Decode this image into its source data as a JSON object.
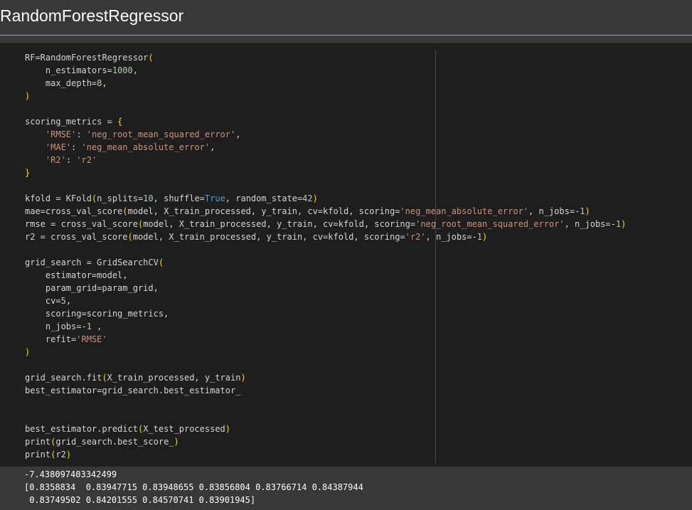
{
  "title": "RandomForestRegressor",
  "colors": {
    "string": "#ce9178",
    "number": "#b5cea8",
    "keyword": "#569cd6",
    "bracket": "#ffd700",
    "text": "#d4d4d4",
    "cell_background": "#1e1e1e",
    "page_background": "#383838"
  },
  "code_lines": [
    [
      {
        "t": "RF=RandomForestRegressor"
      },
      {
        "t": "(",
        "c": "br"
      }
    ],
    [
      {
        "t": "    n_estimators="
      },
      {
        "t": "1000",
        "c": "num"
      },
      {
        "t": ","
      }
    ],
    [
      {
        "t": "    max_depth="
      },
      {
        "t": "8",
        "c": "num"
      },
      {
        "t": ","
      }
    ],
    [
      {
        "t": ")",
        "c": "br"
      }
    ],
    [],
    [
      {
        "t": "scoring_metrics = "
      },
      {
        "t": "{",
        "c": "br"
      }
    ],
    [
      {
        "t": "    "
      },
      {
        "t": "'RMSE'",
        "c": "str"
      },
      {
        "t": ": "
      },
      {
        "t": "'neg_root_mean_squared_error'",
        "c": "str"
      },
      {
        "t": ","
      }
    ],
    [
      {
        "t": "    "
      },
      {
        "t": "'MAE'",
        "c": "str"
      },
      {
        "t": ": "
      },
      {
        "t": "'neg_mean_absolute_error'",
        "c": "str"
      },
      {
        "t": ","
      }
    ],
    [
      {
        "t": "    "
      },
      {
        "t": "'R2'",
        "c": "str"
      },
      {
        "t": ": "
      },
      {
        "t": "'r2'",
        "c": "str"
      }
    ],
    [
      {
        "t": "}",
        "c": "br"
      }
    ],
    [],
    [
      {
        "t": "kfold = KFold"
      },
      {
        "t": "(",
        "c": "br"
      },
      {
        "t": "n_splits="
      },
      {
        "t": "10",
        "c": "num"
      },
      {
        "t": ", shuffle="
      },
      {
        "t": "True",
        "c": "kw"
      },
      {
        "t": ", random_state="
      },
      {
        "t": "42",
        "c": "num"
      },
      {
        "t": ")",
        "c": "br"
      }
    ],
    [
      {
        "t": "mae=cross_val_score"
      },
      {
        "t": "(",
        "c": "br"
      },
      {
        "t": "model, X_train_processed, y_train, cv=kfold, scoring="
      },
      {
        "t": "'neg_mean_absolute_error'",
        "c": "str"
      },
      {
        "t": ", n_jobs=-"
      },
      {
        "t": "1",
        "c": "num"
      },
      {
        "t": ")",
        "c": "br"
      }
    ],
    [
      {
        "t": "rmse = cross_val_score"
      },
      {
        "t": "(",
        "c": "br"
      },
      {
        "t": "model, X_train_processed, y_train, cv=kfold, scoring="
      },
      {
        "t": "'neg_root_mean_squared_error'",
        "c": "str"
      },
      {
        "t": ", n_jobs=-"
      },
      {
        "t": "1",
        "c": "num"
      },
      {
        "t": ")",
        "c": "br"
      }
    ],
    [
      {
        "t": "r2 = cross_val_score"
      },
      {
        "t": "(",
        "c": "br"
      },
      {
        "t": "model, X_train_processed, y_train, cv=kfold, scoring="
      },
      {
        "t": "'r2'",
        "c": "str"
      },
      {
        "t": ", n_jobs=-"
      },
      {
        "t": "1",
        "c": "num"
      },
      {
        "t": ")",
        "c": "br"
      }
    ],
    [],
    [
      {
        "t": "grid_search = GridSearchCV"
      },
      {
        "t": "(",
        "c": "br"
      }
    ],
    [
      {
        "t": "    estimator=model,"
      }
    ],
    [
      {
        "t": "    param_grid=param_grid,"
      }
    ],
    [
      {
        "t": "    cv="
      },
      {
        "t": "5",
        "c": "num"
      },
      {
        "t": ","
      }
    ],
    [
      {
        "t": "    scoring=scoring_metrics,"
      }
    ],
    [
      {
        "t": "    n_jobs=-"
      },
      {
        "t": "1",
        "c": "num"
      },
      {
        "t": " ,"
      }
    ],
    [
      {
        "t": "    refit="
      },
      {
        "t": "'RMSE'",
        "c": "str"
      }
    ],
    [
      {
        "t": ")",
        "c": "br"
      }
    ],
    [],
    [
      {
        "t": "grid_search.fit"
      },
      {
        "t": "(",
        "c": "br"
      },
      {
        "t": "X_train_processed, y_train"
      },
      {
        "t": ")",
        "c": "br"
      }
    ],
    [
      {
        "t": "best_estimator=grid_search.best_estimator_"
      }
    ],
    [],
    [],
    [
      {
        "t": "best_estimator.predict"
      },
      {
        "t": "(",
        "c": "br"
      },
      {
        "t": "X_test_processed"
      },
      {
        "t": ")",
        "c": "br"
      }
    ],
    [
      {
        "t": "print"
      },
      {
        "t": "(",
        "c": "br"
      },
      {
        "t": "grid_search.best_score_"
      },
      {
        "t": ")",
        "c": "br"
      }
    ],
    [
      {
        "t": "print"
      },
      {
        "t": "(",
        "c": "br"
      },
      {
        "t": "r2"
      },
      {
        "t": ")",
        "c": "br"
      }
    ]
  ],
  "output_lines": [
    "-7.438097403342499",
    "[0.8358834  0.83947715 0.83948655 0.83856804 0.83766714 0.84387944",
    " 0.83749502 0.84201555 0.84570741 0.83901945]"
  ]
}
